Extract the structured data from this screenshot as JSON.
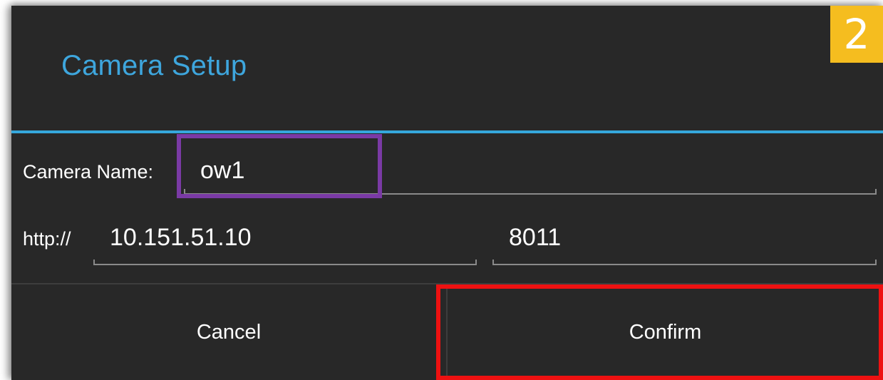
{
  "dialog": {
    "title": "Camera Setup",
    "step_badge": "2"
  },
  "form": {
    "camera_name_label": "Camera Name:",
    "camera_name_value": "ow1",
    "protocol_label": "http://",
    "host_value": "10.151.51.10",
    "port_value": "8011"
  },
  "buttons": {
    "cancel_label": "Cancel",
    "confirm_label": "Confirm"
  },
  "colors": {
    "title": "#3ea6dd",
    "accent_line": "#35a7dc",
    "badge": "#f5bd1f",
    "name_highlight": "#7a3aa5",
    "confirm_highlight": "#ee1111",
    "dialog_background": "#282828"
  }
}
